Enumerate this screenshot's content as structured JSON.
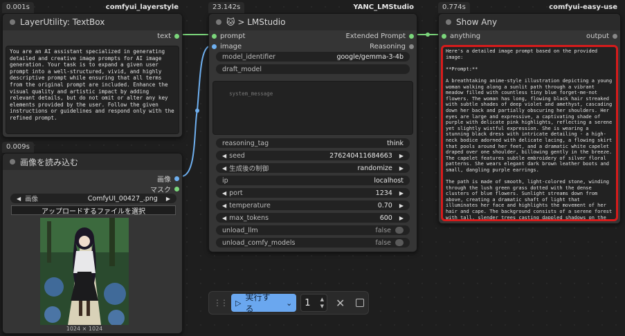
{
  "colors": {
    "link_green": "#7bd67b",
    "link_blue": "#6fb0f0",
    "highlight_red": "#d81b1b",
    "run_blue": "#6aa7ef"
  },
  "node_textbox": {
    "time": "0.001s",
    "pack": "comfyui_layerstyle",
    "title": "LayerUtility: TextBox",
    "output_label": "text",
    "text": "You are an AI assistant specialized in generating detailed and creative image prompts for AI image generation. Your task is to expand a given user prompt into a well-structured, vivid, and highly descriptive prompt while ensuring that all terms from the original prompt are included. Enhance the visual quality and artistic impact by adding relevant details, but do not omit or alter any key elements provided by the user. Follow the given instructions or guidelines and respond only with the refined prompt."
  },
  "node_loadimage": {
    "time": "0.009s",
    "title": "画像を読み込む",
    "output_image": "画像",
    "output_mask": "マスク",
    "image_label": "画像",
    "image_value": "ComfyUI_00427_.png",
    "upload_label": "アップロードするファイルを選択",
    "dims": "1024 × 1024"
  },
  "node_lmstudio": {
    "time": "23.142s",
    "pack": "YANC_LMStudio",
    "title": "🐱 > LMStudio",
    "input_prompt": "prompt",
    "input_image": "image",
    "output_extended": "Extended Prompt",
    "output_reasoning": "Reasoning",
    "model_identifier_label": "model_identifier",
    "model_identifier_value": "google/gemma-3-4b",
    "draft_model_label": "draft_model",
    "system_message_placeholder": "system_message",
    "reasoning_tag_label": "reasoning_tag",
    "reasoning_tag_value": "think",
    "seed_label": "seed",
    "seed_value": "276240411684663",
    "control_label": "生成後の制御",
    "control_value": "randomize",
    "ip_label": "ip",
    "ip_value": "localhost",
    "port_label": "port",
    "port_value": "1234",
    "temperature_label": "temperature",
    "temperature_value": "0.70",
    "max_tokens_label": "max_tokens",
    "max_tokens_value": "600",
    "unload_llm_label": "unload_llm",
    "unload_llm_value": "false",
    "unload_comfy_label": "unload_comfy_models",
    "unload_comfy_value": "false"
  },
  "node_showany": {
    "time": "0.774s",
    "pack": "comfyui-easy-use",
    "title": "Show Any",
    "input_label": "anything",
    "output_label": "output",
    "text": "Here's a detailed image prompt based on the provided image:\n\n**Prompt:**\n\nA breathtaking anime-style illustration depicting a young woman walking along a sunlit path through a vibrant meadow filled with countless tiny blue forget-me-not flowers. The woman has long, flowing black hair streaked with subtle shades of deep violet and amethyst, cascading down her back and partially obscuring her shoulders. Her eyes are large and expressive, a captivating shade of purple with delicate pink highlights, reflecting a serene yet slightly wistful expression. She is wearing a stunning black dress with intricate detailing - a high-neck bodice adorned with delicate lacing, a flowing skirt that pools around her feet, and a dramatic white capelet draped over one shoulder, billowing gently in the breeze. The capelet features subtle embroidery of silver floral patterns. She wears elegant dark brown leather boots and small, dangling purple earrings.\n\nThe path is made of smooth, light-colored stone, winding through the lush green grass dotted with the dense clusters of blue flowers. Sunlight streams down from above, creating a dramatic shaft of light that illuminates her face and highlights the movement of her hair and cape. The background consists of a serene forest with tall, slender trees casting dappled shadows on the ground. The overall atmosphere is one of tranquility, beauty, and gentle melancholy.  Rendered in a highly detailed anime style with soft lighting, vibrant colors, and a focus on intricate textures - emphasizing the fabric of her dress, the flow of her hair, and the delicate petals of the flowers. Use a painterly brushstroke effect to enhance the depth and realism. Cinematic composition, 8k resolution, masterpiece."
  },
  "toolbar": {
    "run_label": "実行する",
    "count": "1"
  }
}
